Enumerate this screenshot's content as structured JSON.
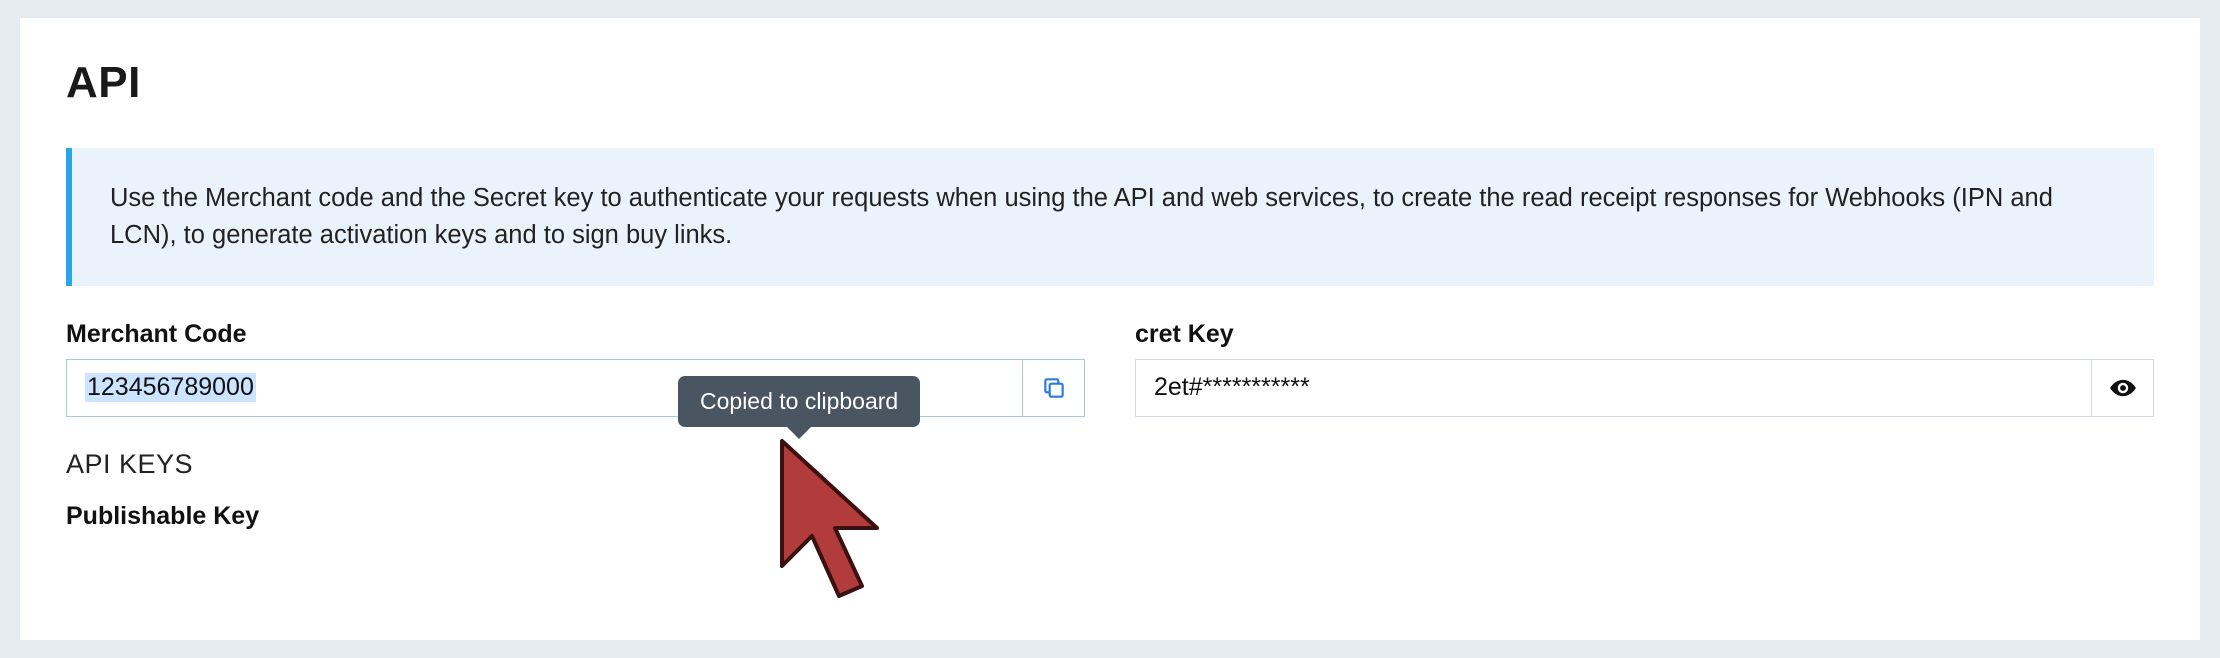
{
  "page": {
    "title": "API",
    "info_text": "Use the Merchant code and the Secret key to authenticate your requests when using the API and web services, to create the read receipt responses for Webhooks (IPN and LCN), to generate activation keys and to sign buy links."
  },
  "merchant": {
    "label": "Merchant Code",
    "value": "123456789000"
  },
  "secret": {
    "label": "cret Key",
    "value": "2et#***********"
  },
  "tooltip": {
    "text": "Copied to clipboard"
  },
  "api_keys": {
    "heading": "API KEYS",
    "publishable_label": "Publishable Key"
  }
}
